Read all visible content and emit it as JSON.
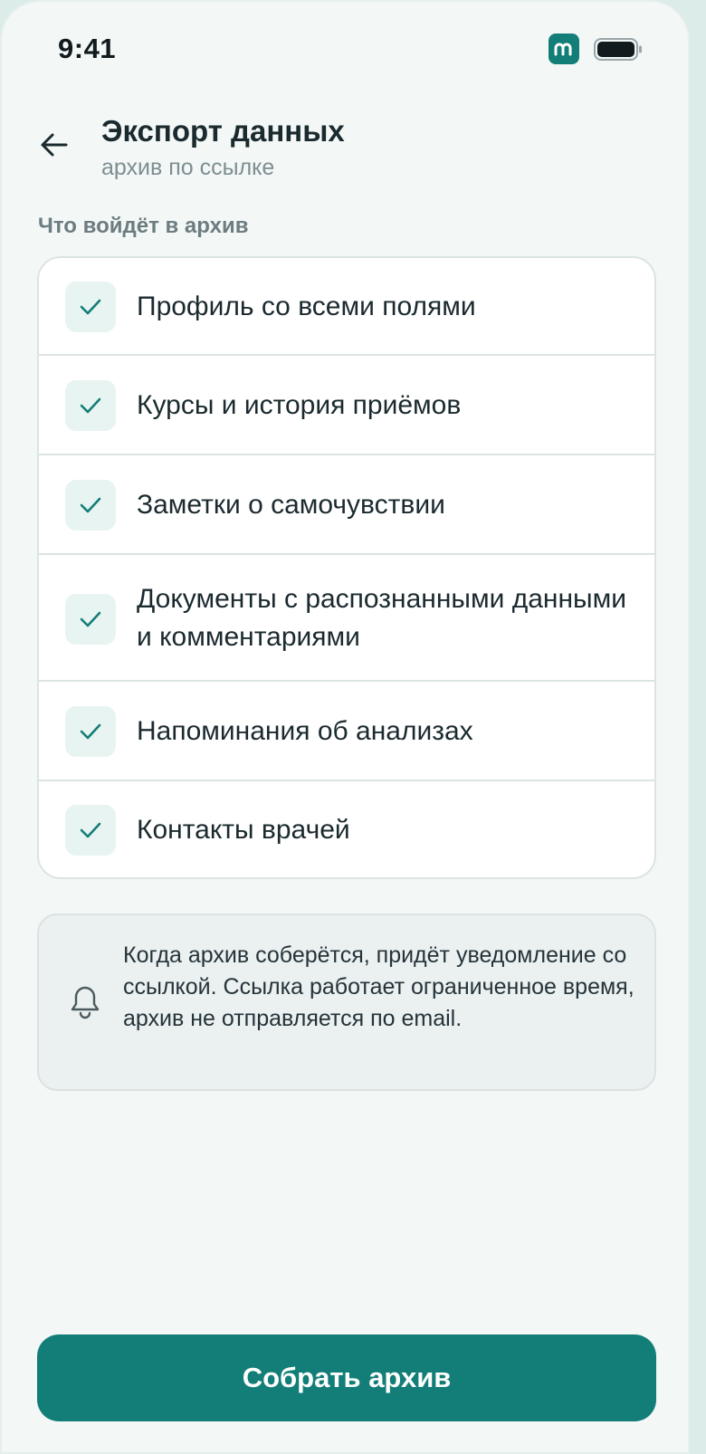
{
  "status_bar": {
    "time": "9:41",
    "app_badge_icon": "app-m-icon",
    "battery_icon": "battery-icon"
  },
  "header": {
    "title": "Экспорт данных",
    "subtitle": "архив по ссылке",
    "back_icon": "back-arrow-icon"
  },
  "section": {
    "label": "Что войдёт в архив"
  },
  "checklist": {
    "items": [
      {
        "label": "Профиль со всеми полями",
        "checked": true
      },
      {
        "label": "Курсы и история приёмов",
        "checked": true
      },
      {
        "label": "Заметки о самочувствии",
        "checked": true
      },
      {
        "label": "Документы с распознанными данными и комментариями",
        "checked": true
      },
      {
        "label": "Напоминания об анализах",
        "checked": true
      },
      {
        "label": "Контакты врачей",
        "checked": true
      }
    ]
  },
  "notice": {
    "icon": "bell-icon",
    "text": "Когда архив соберётся, придёт уведомление со ссылкой. Ссылка работает ограниченное время, архив не отправляется по email."
  },
  "action": {
    "button_label": "Собрать архив"
  },
  "colors": {
    "accent": "#127e77",
    "background": "#f3f8f7",
    "card": "#ffffff",
    "check_bg": "#e8f4f1",
    "text": "#1b2a2f"
  }
}
